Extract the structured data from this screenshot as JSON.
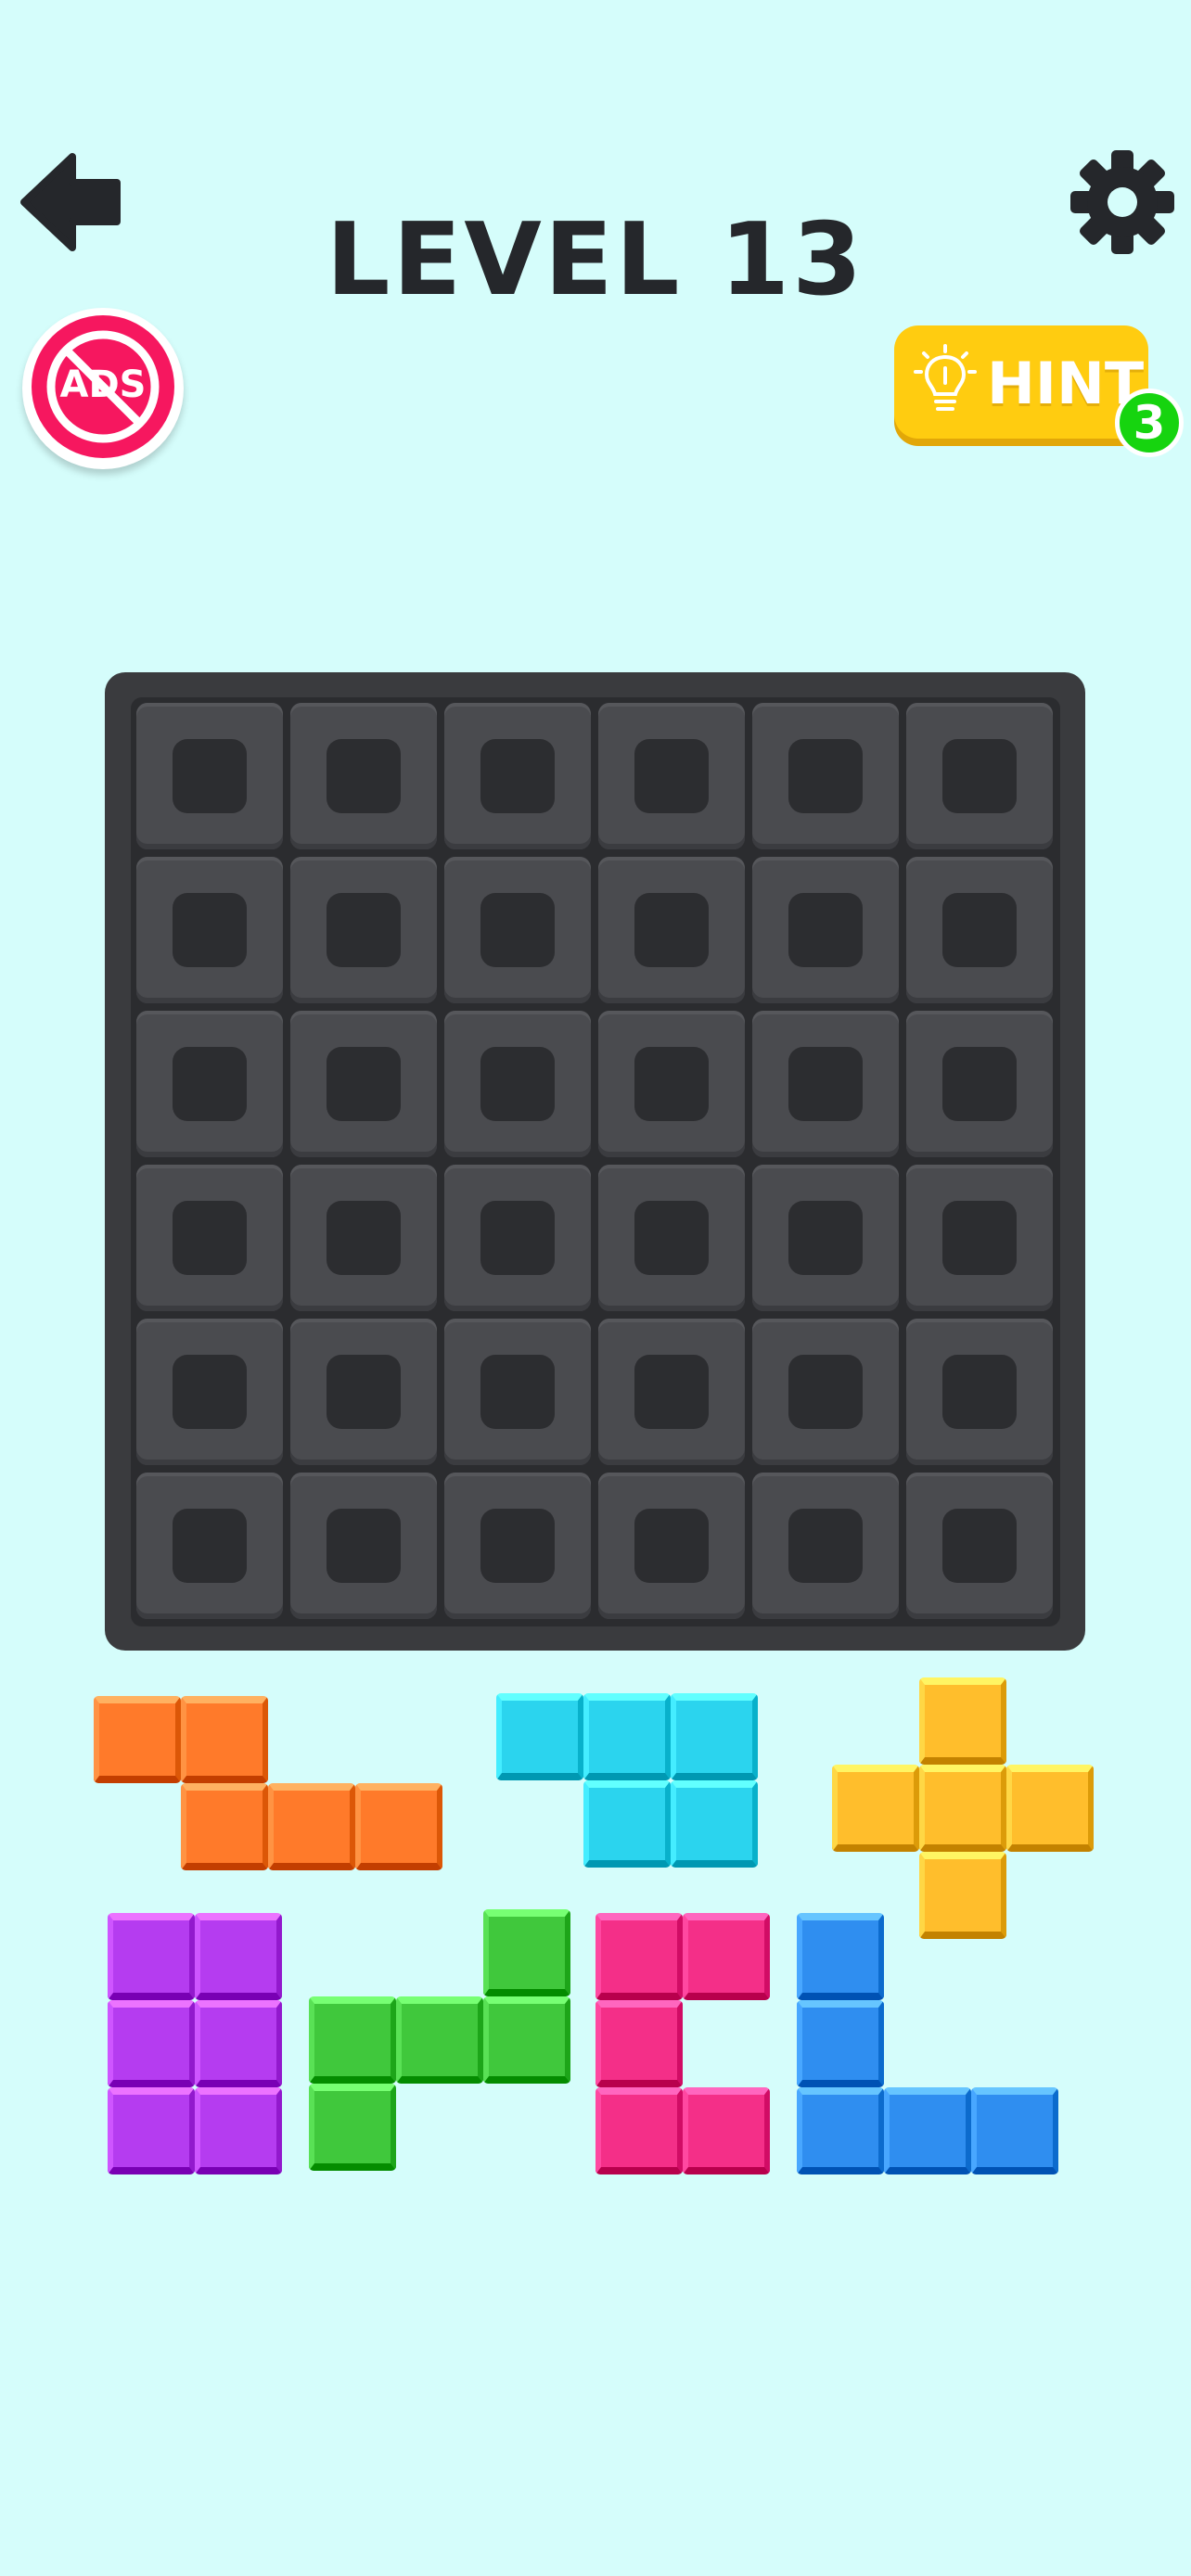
{
  "header": {
    "back_icon": "back-arrow-icon",
    "title": "LEVEL 13",
    "settings_icon": "gear-icon"
  },
  "ads_button": {
    "label": "ADS",
    "icon": "no-ads-icon",
    "color": "#f6175f"
  },
  "hint_button": {
    "label": "HINT",
    "icon": "lightbulb-icon",
    "count": "3",
    "color": "#ffcc10",
    "badge_color": "#16d40f"
  },
  "board": {
    "rows": 6,
    "cols": 6,
    "filled_cells": 0
  },
  "pieces": [
    {
      "name": "orange-piece",
      "color": "#ff7a2a"
    },
    {
      "name": "cyan-piece",
      "color": "#2bd4ee"
    },
    {
      "name": "yellow-piece",
      "color": "#ffbe2c"
    },
    {
      "name": "purple-piece",
      "color": "#b53cf0"
    },
    {
      "name": "green-piece",
      "color": "#40c83c"
    },
    {
      "name": "pink-piece",
      "color": "#f42f88"
    },
    {
      "name": "blue-piece",
      "color": "#2f8ef0"
    }
  ]
}
